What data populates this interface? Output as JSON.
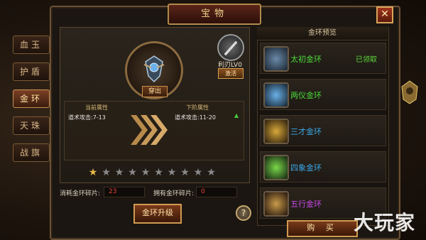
{
  "window": {
    "title": "宝物",
    "close": "✕"
  },
  "tabs": [
    {
      "label": "血玉",
      "active": false
    },
    {
      "label": "护盾",
      "active": false
    },
    {
      "label": "金环",
      "active": true
    },
    {
      "label": "天珠",
      "active": false
    },
    {
      "label": "战旗",
      "active": false
    }
  ],
  "equip": {
    "button": "穿出"
  },
  "weapon": {
    "level_label": "利刃LV0",
    "button": "激活"
  },
  "attributes": {
    "current_title": "当前属性",
    "current_value": "道术攻击:7-13",
    "next_title": "下阶属性",
    "next_value": "道术攻击:11-20"
  },
  "stars": {
    "filled": 1,
    "total": 10
  },
  "cost": {
    "consume_label": "消耗金环碎片:",
    "consume_value": "23",
    "own_label": "拥有金环碎片:",
    "own_value": "0"
  },
  "upgrade_button": "金环升级",
  "help": "?",
  "preview": {
    "title": "金环预览",
    "items": [
      {
        "name": "太初金环",
        "status": "已领取",
        "color": "#4ad83a",
        "icon": "ring-icon-1"
      },
      {
        "name": "两仪金环",
        "status": "",
        "color": "#4ad83a",
        "icon": "ring-icon-2"
      },
      {
        "name": "三才金环",
        "status": "",
        "color": "#3aa8e8",
        "icon": "ring-icon-3"
      },
      {
        "name": "四象金环",
        "status": "",
        "color": "#3aa8e8",
        "icon": "ring-icon-4"
      },
      {
        "name": "五行金环",
        "status": "",
        "color": "#c84ae8",
        "icon": "ring-icon-5"
      }
    ]
  },
  "buy_button": "购 买",
  "watermark": "大玩家",
  "colors": {
    "accent": "#d09a52",
    "cost_red": "#e8423a",
    "green": "#4ad83a"
  }
}
